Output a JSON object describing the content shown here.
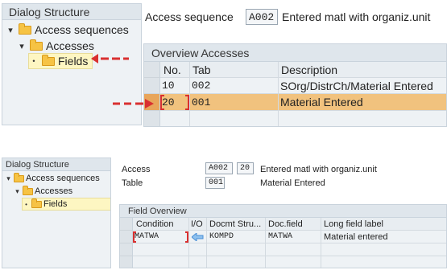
{
  "top": {
    "dialog_structure": {
      "title": "Dialog Structure",
      "items": [
        {
          "label": "Access sequences",
          "toggle": "▾"
        },
        {
          "label": "Accesses",
          "toggle": "▾"
        },
        {
          "label": "Fields",
          "toggle": "•"
        }
      ]
    },
    "access_sequence": {
      "label": "Access sequence",
      "code": "A002",
      "description": "Entered matl with organiz.unit"
    },
    "overview": {
      "title": "Overview Accesses",
      "columns": [
        "No.",
        "Tab",
        "Description"
      ],
      "rows": [
        {
          "no": "10",
          "tab": "002",
          "description": "SOrg/DistrCh/Material Entered"
        },
        {
          "no": "20",
          "tab": "001",
          "description": "Material Entered"
        }
      ]
    }
  },
  "bottom": {
    "dialog_structure": {
      "title": "Dialog Structure",
      "items": [
        {
          "label": "Access sequences",
          "toggle": "▾"
        },
        {
          "label": "Accesses",
          "toggle": "▾"
        },
        {
          "label": "Fields",
          "toggle": "•"
        }
      ]
    },
    "access": {
      "label": "Access",
      "code": "A002",
      "number": "20",
      "description": "Entered matl with organiz.unit"
    },
    "table": {
      "label": "Table",
      "code": "001",
      "description": "Material Entered"
    },
    "field_overview": {
      "title": "Field Overview",
      "columns": [
        "Condition",
        "I/O",
        "Docmt Stru...",
        "Doc.field",
        "Long field label"
      ],
      "rows": [
        {
          "condition": "MATWA",
          "io": "⇦",
          "docmt_structure": "KOMPD",
          "doc_field": "MATWA",
          "long_label": "Material entered"
        }
      ]
    }
  },
  "colors": {
    "highlight_row": "#f1c27e",
    "annotation_arrow": "#d93030",
    "folder": "#f6c344",
    "io_arrow": "#4a8fd6"
  }
}
